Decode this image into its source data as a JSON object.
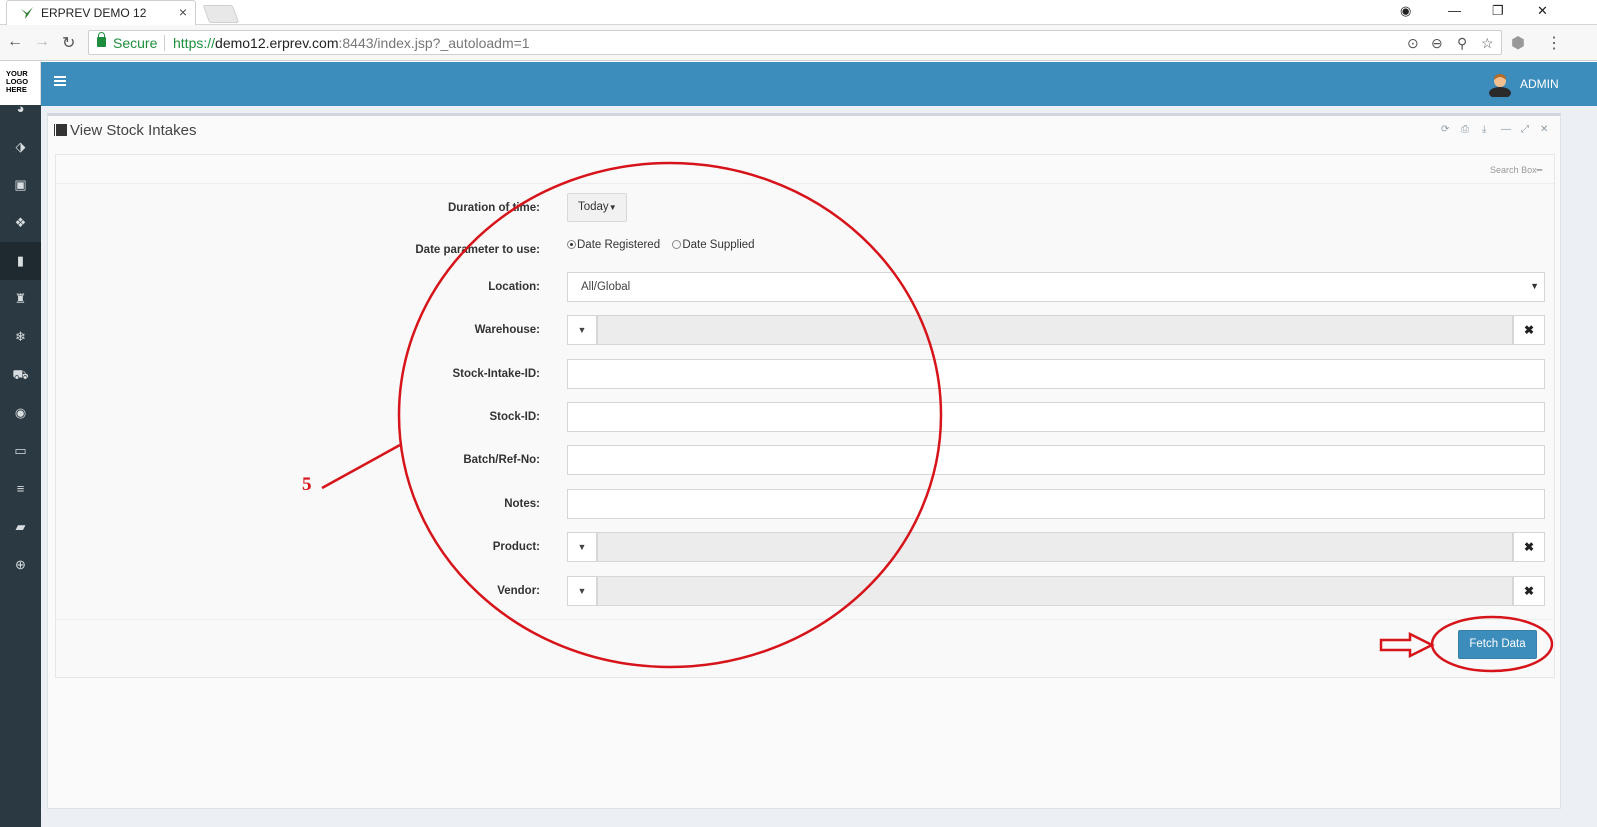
{
  "browser": {
    "tab_title": "ERPREV DEMO 12",
    "tab_close": "×",
    "secure_label": "Secure",
    "url_scheme": "https://",
    "url_host": "demo12.erprev.com",
    "url_path": ":8443/index.jsp?_autoloadm=1"
  },
  "app": {
    "logo_line1": "YOUR",
    "logo_line2": "LOGO",
    "logo_line3": "HERE",
    "user_name": "ADMIN",
    "accent_color": "#3c8dbc"
  },
  "sidebar": {
    "items": [
      {
        "icon": "dashboard-icon",
        "glyph": "◕"
      },
      {
        "icon": "tag-icon",
        "glyph": "⬗"
      },
      {
        "icon": "money-icon",
        "glyph": "▣"
      },
      {
        "icon": "cubes-icon",
        "glyph": "❖"
      },
      {
        "icon": "building-icon",
        "glyph": "▮"
      },
      {
        "icon": "bucket-icon",
        "glyph": "♜"
      },
      {
        "icon": "snowflake-icon",
        "glyph": "❄"
      },
      {
        "icon": "cart-icon",
        "glyph": "⛟"
      },
      {
        "icon": "feed-icon",
        "glyph": "◉"
      },
      {
        "icon": "desktop-icon",
        "glyph": "▭"
      },
      {
        "icon": "database-icon",
        "glyph": "≡"
      },
      {
        "icon": "book-icon",
        "glyph": "▰"
      },
      {
        "icon": "lifebuoy-icon",
        "glyph": "⊕"
      }
    ]
  },
  "panel": {
    "title": "View Stock Intakes",
    "search_box_label": "Search Box"
  },
  "form": {
    "duration_label": "Duration of time:",
    "duration_value": "Today",
    "date_param_label": "Date parameter to use:",
    "date_options": [
      "Date Registered",
      "Date Supplied"
    ],
    "date_selected": "Date Registered",
    "location_label": "Location:",
    "location_value": "All/Global",
    "warehouse_label": "Warehouse:",
    "stock_intake_id_label": "Stock-Intake-ID:",
    "stock_id_label": "Stock-ID:",
    "batch_label": "Batch/Ref-No:",
    "notes_label": "Notes:",
    "product_label": "Product:",
    "vendor_label": "Vendor:",
    "clear_glyph": "✖",
    "toggle_glyph": "▼"
  },
  "actions": {
    "fetch_label": "Fetch Data"
  },
  "annotation": {
    "number": "5",
    "color": "#d6141a"
  }
}
